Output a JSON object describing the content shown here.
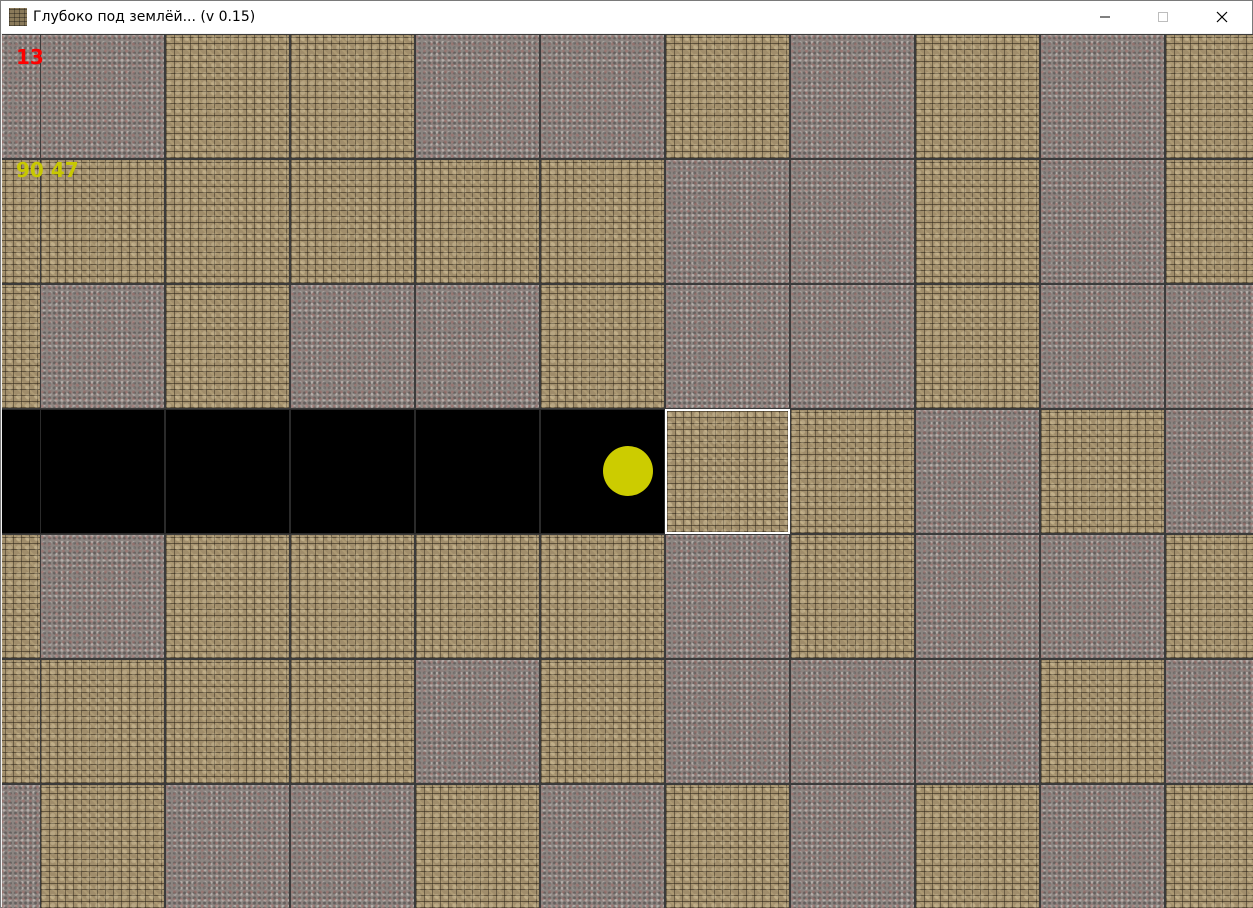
{
  "window": {
    "title": "Глубоко под землёй... (v 0.15)",
    "minimize_glyph": "—",
    "maximize_glyph": "☐",
    "close_glyph": "✕",
    "icon": "stone-tile-icon"
  },
  "hud": {
    "depth": "13",
    "coords": "90 47"
  },
  "map": {
    "rows": 7,
    "cols": 11,
    "tiles": [
      [
        "granite",
        "granite",
        "cobble",
        "cobble",
        "granite",
        "granite",
        "cobble",
        "granite",
        "cobble",
        "granite",
        "cobble"
      ],
      [
        "cobble",
        "cobble",
        "cobble",
        "cobble",
        "cobble",
        "cobble",
        "granite",
        "granite",
        "cobble",
        "granite",
        "cobble"
      ],
      [
        "cobble",
        "granite",
        "cobble",
        "granite",
        "granite",
        "cobble",
        "granite",
        "granite",
        "cobble",
        "granite",
        "granite"
      ],
      [
        "dug",
        "dug",
        "dug",
        "dug",
        "dug",
        "dug",
        "cobble",
        "cobble",
        "granite",
        "cobble",
        "granite"
      ],
      [
        "cobble",
        "granite",
        "cobble",
        "cobble",
        "cobble",
        "cobble",
        "granite",
        "cobble",
        "granite",
        "granite",
        "cobble"
      ],
      [
        "cobble",
        "cobble",
        "cobble",
        "cobble",
        "granite",
        "cobble",
        "granite",
        "granite",
        "granite",
        "cobble",
        "granite"
      ],
      [
        "granite",
        "cobble",
        "granite",
        "granite",
        "cobble",
        "granite",
        "cobble",
        "granite",
        "cobble",
        "granite",
        "cobble"
      ]
    ],
    "selected": {
      "row": 3,
      "col": 6
    },
    "player": {
      "row": 3,
      "col": 5
    }
  },
  "colors": {
    "depth_text": "#ff0000",
    "coords_text": "#c8c800",
    "player": "#cccc00",
    "dug": "#000000",
    "selection_border": "#ffffff"
  }
}
